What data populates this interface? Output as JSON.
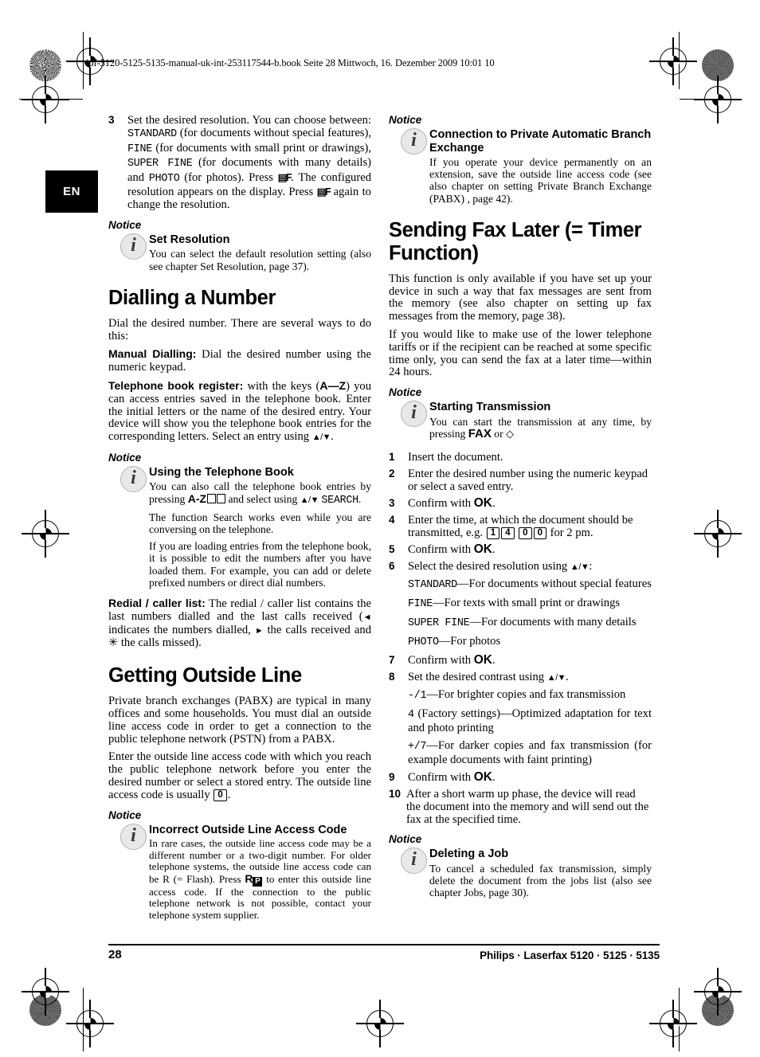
{
  "document": {
    "header_line": "lpf-5120-5125-5135-manual-uk-int-253117544-b.book  Seite 28  Mittwoch, 16. Dezember 2009  10:01 10",
    "language_tab": "EN",
    "footer_page_number": "28",
    "footer_title": "Philips · Laserfax 5120 · 5125 · 5135"
  },
  "left_column": {
    "step3": {
      "number": "3",
      "text_a": "Set the desired resolution. You can choose between: ",
      "lcd_standard": "STANDARD",
      "text_b": " (for documents without special features), ",
      "lcd_fine": "FINE",
      "text_c": " (for documents with small print or drawings), ",
      "lcd_superfine": "SUPER FINE",
      "text_d": " (for documents with many details) and ",
      "lcd_photo": "PHOTO",
      "text_e": " (for photos). Press ",
      "icon_resolution": "resolution-key-icon",
      "text_f": ". The configured resolution appears on the display. Press ",
      "text_g": " again to change the resolution."
    },
    "notice1": {
      "label": "Notice",
      "title": "Set Resolution",
      "body": "You can select the default resolution setting (also see chapter Set Resolution, page 37)."
    },
    "heading_dialling": "Dialling a Number",
    "para_dial_intro": "Dial the desired number. There are several ways to do this:",
    "manual_dialling": {
      "term": "Manual Dialling:",
      "text": " Dial the desired number using the numeric keypad."
    },
    "telephone_book_register": {
      "term": "Telephone book register:",
      "text_a": " with the keys (",
      "keys": "A—Z",
      "text_b": ") you can access entries saved in the telephone book. Enter the initial letters or the name of the desired entry. Your device will show you the telephone book entries for the corresponding letters. Select an entry using ",
      "arrows": "▲/▼",
      "text_c": "."
    },
    "notice2": {
      "label": "Notice",
      "title": "Using the Telephone Book",
      "body_a": "You can also call the telephone book entries by pressing ",
      "key_az": "A-Z",
      "body_b": " and select using ",
      "arrows": "▲/▼",
      "lcd_search": "SEARCH",
      "body_c": ".",
      "body2": "The function Search works even while you are conversing on the telephone.",
      "body3": "If you are loading entries from the telephone book, it is possible to edit the numbers after you have loaded them. For example, you can add or delete prefixed numbers or direct dial numbers."
    },
    "redial": {
      "term": "Redial / caller list:",
      "text_a": " The redial / caller list contains the last numbers dialled and the last calls received (",
      "icon_dialled": "◄",
      "text_b": " indicates the numbers dialled, ",
      "icon_received": "►",
      "text_c": " the calls received and ",
      "icon_missed": "✳",
      "text_d": " the calls missed)."
    },
    "heading_outside_line": "Getting Outside Line",
    "para_pabx": "Private branch exchanges (PABX) are typical in many offices and some households. You must dial an outside line access code in order to get a connection to the public telephone network (PSTN) from a PABX.",
    "para_access_code": {
      "text_a": "Enter the outside line access code with which you reach the public telephone network before you enter the desired number or select a stored entry. The outside line access code is usually ",
      "keycap": "0",
      "text_b": "."
    },
    "notice3": {
      "label": "Notice",
      "title": "Incorrect Outside Line Access Code",
      "body_a": "In rare cases, the outside line access code may be a different number or a two-digit number. For older telephone systems, the outside line access code can be R (= Flash). Press ",
      "key_r": "R",
      "glyph_p": "P",
      "body_b": " to enter this outside line access code. If the connection to the public telephone network is not possible, contact your telephone system supplier."
    }
  },
  "right_column": {
    "notice4": {
      "label": "Notice",
      "title": "Connection to Private Automatic Branch Exchange",
      "body": "If you operate your device permanently on an extension, save the outside line access code (see also chapter on  setting Private Branch Exchange (PABX) , page  42)."
    },
    "heading_timer": "Sending Fax Later (= Timer Function)",
    "para_timer1": "This function is only available if you have set up your device in such a way that fax messages are sent from the memory (see also chapter on  setting up fax messages from the memory, page  38).",
    "para_timer2": "If you would like to make use of the lower telephone tariffs or if the recipient can be reached at some specific time only, you can send the fax at a later time—within 24 hours.",
    "notice5": {
      "label": "Notice",
      "title": "Starting Transmission",
      "body_a": "You can start the transmission at any time, by pressing ",
      "key_fax": "FAX",
      "body_b": " or ",
      "icon_start": "◇"
    },
    "steps": [
      {
        "number": "1",
        "text": "Insert the document."
      },
      {
        "number": "2",
        "text": "Enter the desired number using the numeric keypad or select a saved entry."
      },
      {
        "number": "3",
        "text_a": "Confirm with ",
        "key": "OK",
        "text_b": "."
      },
      {
        "number": "4",
        "text_a": "Enter the time, at which the document should be transmitted, e.g. ",
        "keycaps": [
          "1",
          "4",
          "0",
          "0"
        ],
        "text_b": " for 2 pm."
      },
      {
        "number": "5",
        "text_a": "Confirm with ",
        "key": "OK",
        "text_b": "."
      },
      {
        "number": "6",
        "text_a": "Select the desired resolution using ",
        "arrows": "▲/▼",
        "text_b": ":"
      },
      {
        "number": "7",
        "text_a": "Confirm with ",
        "key": "OK",
        "text_b": "."
      },
      {
        "number": "8",
        "text_a": "Set the desired contrast using ",
        "arrows": "▲/▼",
        "text_b": "."
      },
      {
        "number": "9",
        "text_a": "Confirm with ",
        "key": "OK",
        "text_b": "."
      },
      {
        "number": "10",
        "text": "After a short warm up phase, the device will read the document into the memory and will send out the fax at the specified time."
      }
    ],
    "resolution_options": [
      {
        "lcd": "STANDARD",
        "desc": "—For documents without special features"
      },
      {
        "lcd": "FINE",
        "desc": "—For texts with small print or drawings"
      },
      {
        "lcd": "SUPER FINE",
        "desc": "—For documents with many details"
      },
      {
        "lcd": "PHOTO",
        "desc": "—For photos"
      }
    ],
    "contrast_options": [
      {
        "lcd": "-/1",
        "desc": "—For brighter copies and fax transmission"
      },
      {
        "lcd": "4",
        "desc": " (Factory settings)—Optimized adaptation for text and photo printing"
      },
      {
        "lcd": "+/7",
        "desc": "—For darker copies and fax transmission (for example documents with faint printing)"
      }
    ],
    "notice6": {
      "label": "Notice",
      "title": "Deleting a Job",
      "body": "To cancel a scheduled fax transmission, simply delete the document from the jobs list (also see chapter Jobs, page 30)."
    }
  }
}
